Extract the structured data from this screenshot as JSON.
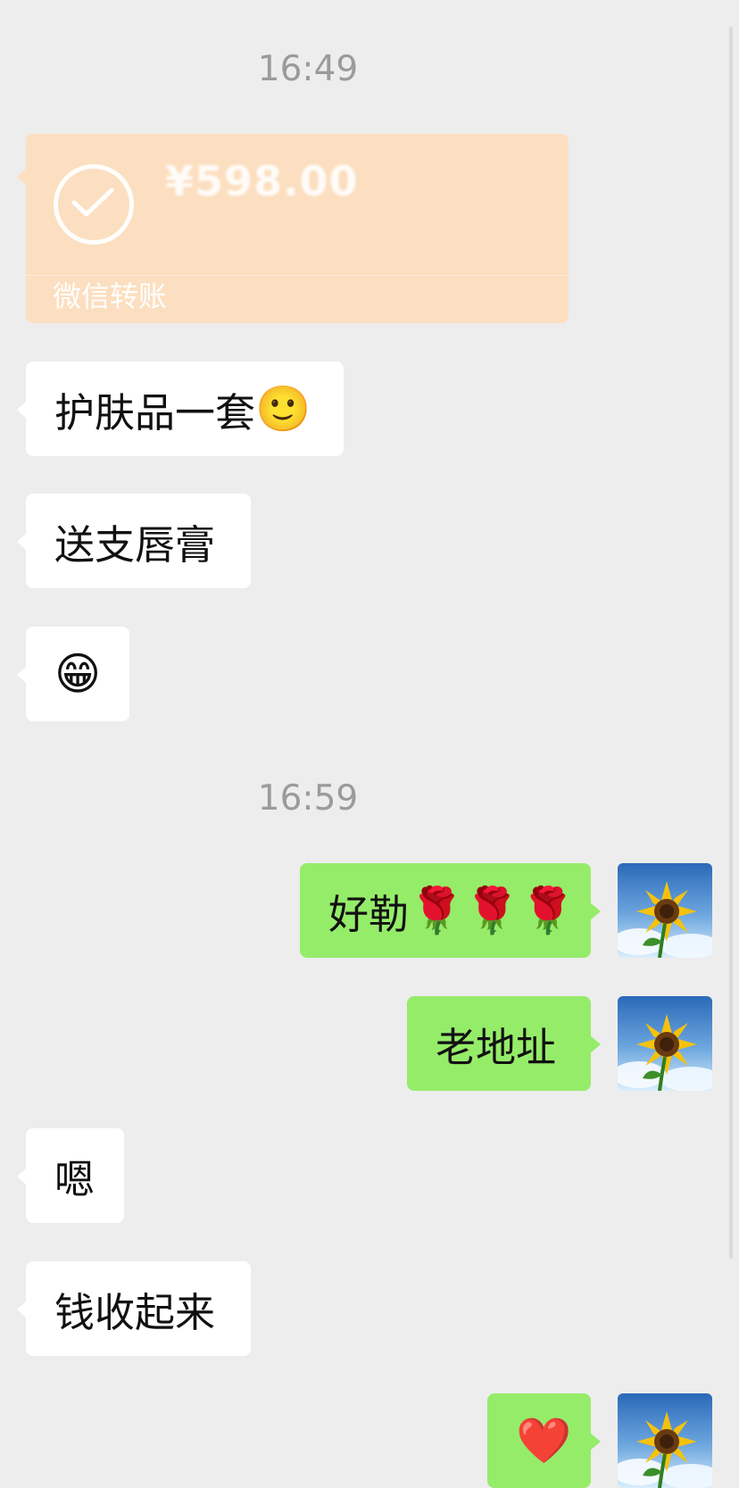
{
  "timestamps": [
    "16:49",
    "16:59"
  ],
  "transfer": {
    "amount": "¥598.00",
    "label": "微信转账"
  },
  "messages": [
    {
      "side": "in",
      "text": "护肤品一套",
      "emoji": "🙂"
    },
    {
      "side": "in",
      "text": "送支唇膏"
    },
    {
      "side": "in",
      "emoji": "😁"
    },
    {
      "side": "out",
      "text": "好勒",
      "emoji": "🌹🌹🌹"
    },
    {
      "side": "out",
      "text": "老地址"
    },
    {
      "side": "in",
      "text": "嗯"
    },
    {
      "side": "in",
      "text": "钱收起来"
    },
    {
      "side": "out",
      "emoji": "❤️"
    }
  ],
  "avatar": {
    "icon": "sunflower-avatar-icon"
  },
  "colors": {
    "background": "#ededed",
    "incoming_bubble": "#ffffff",
    "outgoing_bubble": "#95ec69",
    "transfer_card": "#fcdfc0",
    "timestamp_text": "#9b9b9b"
  }
}
